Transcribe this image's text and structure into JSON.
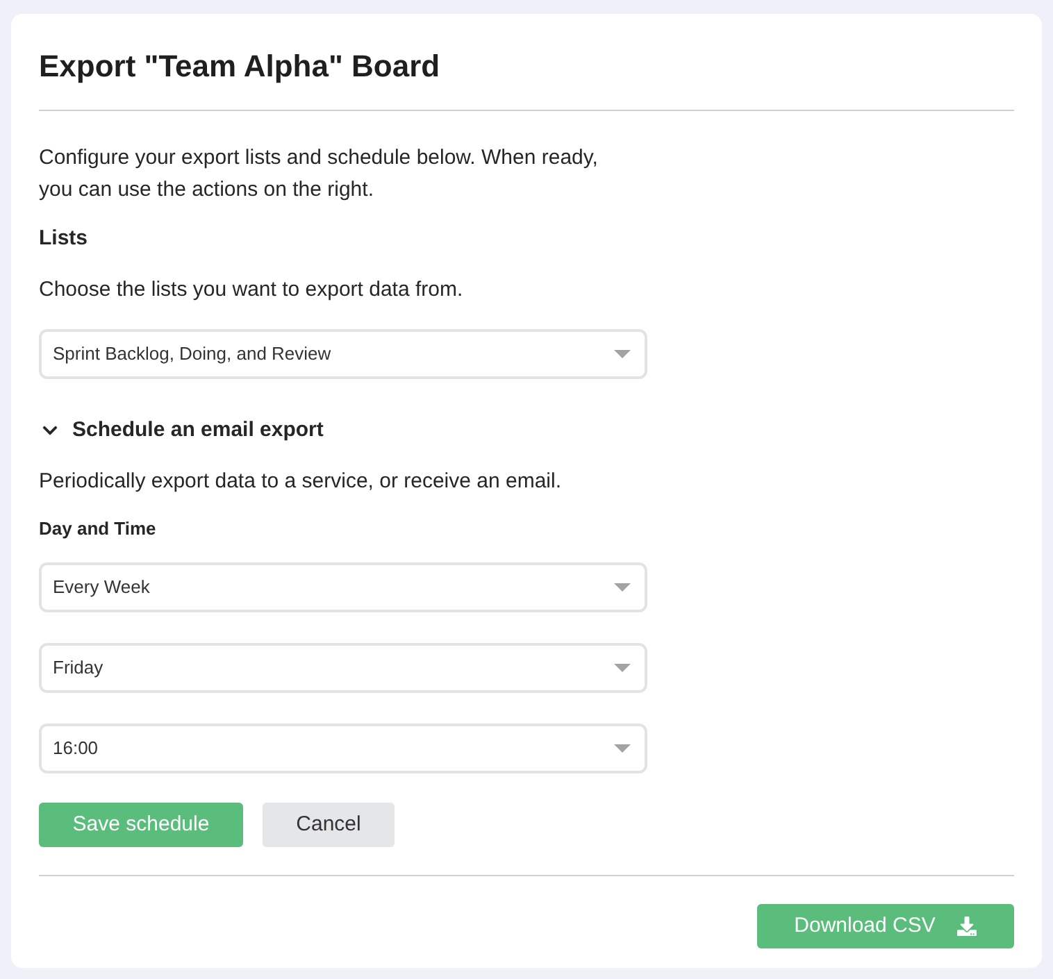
{
  "title": "Export \"Team Alpha\" Board",
  "intro": "Configure your export lists and schedule below. When ready, you can use the actions on the right.",
  "lists": {
    "label": "Lists",
    "help": "Choose the lists you want to export data from.",
    "select": {
      "value": "Sprint Backlog, Doing, and Review"
    }
  },
  "schedule": {
    "title": "Schedule an email export",
    "expanded": true,
    "description": "Periodically export data to a service, or receive an email.",
    "label": "Day and Time",
    "selects": [
      {
        "value": "Every Week"
      },
      {
        "value": "Friday"
      },
      {
        "value": "16:00"
      }
    ],
    "buttons": [
      {
        "label": "Save schedule",
        "kind": "primary"
      },
      {
        "label": "Cancel",
        "kind": "secondary"
      }
    ]
  },
  "footer": {
    "button": {
      "label": "Download CSV",
      "kind": "primary"
    }
  }
}
